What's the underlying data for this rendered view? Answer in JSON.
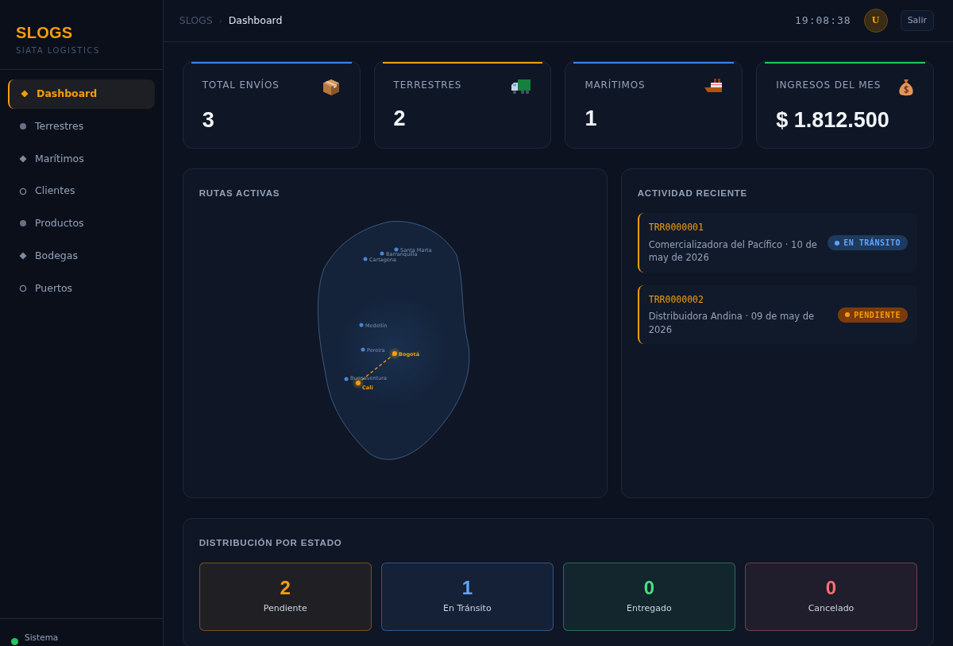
{
  "brand": {
    "title": "SLOGS",
    "subtitle": "SIATA LOGISTICS"
  },
  "sidebar": {
    "items": [
      {
        "label": "Dashboard",
        "kind": "diamond",
        "selected": true
      },
      {
        "label": "Terrestres",
        "kind": "dot",
        "selected": false
      },
      {
        "label": "Marítimos",
        "kind": "diamond",
        "selected": false
      },
      {
        "label": "Clientes",
        "kind": "ring",
        "selected": false
      },
      {
        "label": "Productos",
        "kind": "dot",
        "selected": false
      },
      {
        "label": "Bodegas",
        "kind": "diamond",
        "selected": false
      },
      {
        "label": "Puertos",
        "kind": "ring",
        "selected": false
      }
    ],
    "footer": {
      "label": "Sistema",
      "color": "#22c55e"
    }
  },
  "topbar": {
    "breadcrumb": [
      "SLOGS",
      "Dashboard"
    ],
    "separator": "›",
    "clock": "19:08:38",
    "avatar": "U",
    "logout": "Salir"
  },
  "stats": [
    {
      "label": "TOTAL ENVÍOS",
      "value": "3",
      "kind": "box",
      "color": "#3b82f6"
    },
    {
      "label": "TERRESTRES",
      "value": "2",
      "kind": "truck",
      "color": "#f59e0b"
    },
    {
      "label": "MARÍTIMOS",
      "value": "1",
      "kind": "ship",
      "color": "#3b82f6"
    },
    {
      "label": "INGRESOS DEL MES",
      "value": "$ 1.812.500",
      "kind": "money",
      "color": "#22c55e"
    }
  ],
  "routes": {
    "title": "RUTAS ACTIVAS",
    "cities": [
      {
        "name": "Santa Marta",
        "active": false
      },
      {
        "name": "Barranquilla",
        "active": false
      },
      {
        "name": "Cartagena",
        "active": false
      },
      {
        "name": "Medellín",
        "active": false
      },
      {
        "name": "Pereira",
        "active": false
      },
      {
        "name": "Bogotá",
        "active": true
      },
      {
        "name": "Buenaventura",
        "active": false
      },
      {
        "name": "Cali",
        "active": true
      }
    ]
  },
  "activity": {
    "title": "ACTIVIDAD RECIENTE",
    "items": [
      {
        "code": "TRR0000001",
        "detail": "Comercializadora del Pacífico · 10 de may de 2026",
        "status": "EN TRÁNSITO",
        "kind": "transit"
      },
      {
        "code": "TRR0000002",
        "detail": "Distribuidora Andina · 09 de may de 2026",
        "status": "PENDIENTE",
        "kind": "pending"
      }
    ]
  },
  "distribution": {
    "title": "DISTRIBUCIÓN POR ESTADO",
    "items": [
      {
        "count": "2",
        "label": "Pendiente",
        "color": "#f59e0b"
      },
      {
        "count": "1",
        "label": "En Tránsito",
        "color": "#60a5fa"
      },
      {
        "count": "0",
        "label": "Entregado",
        "color": "#4ade80"
      },
      {
        "count": "0",
        "label": "Cancelado",
        "color": "#f87171"
      }
    ]
  }
}
